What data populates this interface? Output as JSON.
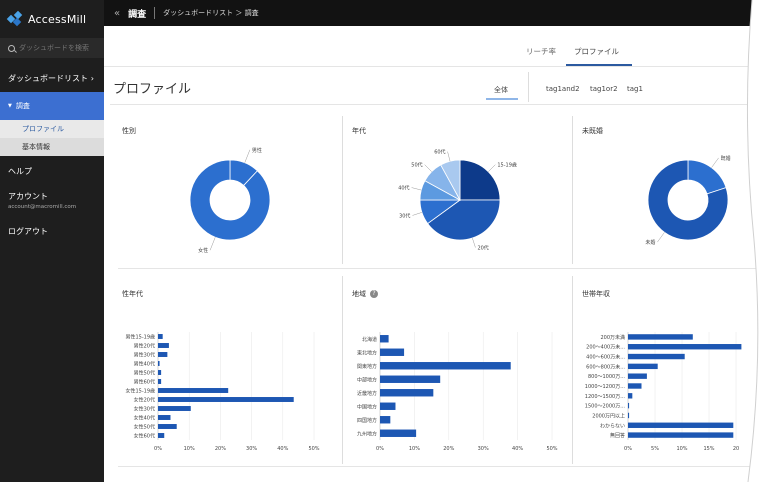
{
  "sidebar": {
    "logo": "AccessMill",
    "search_placeholder": "ダッシュボードを検索",
    "dashboard_list": "ダッシュボードリスト",
    "survey": "調査",
    "sub_items": [
      "プロファイル",
      "基本情報"
    ],
    "help": "ヘルプ",
    "account": "アカウント",
    "email": "account@macromill.com",
    "logout": "ログアウト"
  },
  "topbar": {
    "title": "調査",
    "breadcrumb": "ダッシュボードリスト ＞ 調査"
  },
  "tabs": [
    "リーチ率",
    "プロファイル"
  ],
  "page": {
    "title": "プロファイル"
  },
  "filters": [
    "全体",
    "tag1and2",
    "tag1or2",
    "tag1"
  ],
  "colors": {
    "dark": "#0d3a8a",
    "mid": "#1d57b3",
    "accent": "#2c6fcf",
    "light": "#5c9ae0",
    "pale": "#a9c9ef"
  },
  "chart_data": [
    {
      "type": "pie",
      "title": "性別",
      "donut": true,
      "labels": [
        "男性",
        "女性"
      ],
      "values": [
        12,
        88
      ]
    },
    {
      "type": "pie",
      "title": "年代",
      "labels": [
        "15-19歳",
        "20代",
        "30代",
        "40代",
        "50代",
        "60代"
      ],
      "values": [
        25,
        40,
        10,
        8,
        9,
        8
      ]
    },
    {
      "type": "pie",
      "title": "未既婚",
      "donut": true,
      "labels": [
        "既婚",
        "未婚"
      ],
      "values": [
        20,
        80
      ]
    },
    {
      "type": "bar",
      "title": "性年代",
      "orientation": "horizontal",
      "categories": [
        "男性15-19歳",
        "男性20代",
        "男性30代",
        "男性40代",
        "男性50代",
        "男性60代",
        "女性15-19歳",
        "女性20代",
        "女性30代",
        "女性40代",
        "女性50代",
        "女性60代"
      ],
      "values": [
        1.5,
        3.5,
        3,
        0.5,
        1,
        1,
        22.5,
        43.5,
        10.5,
        4,
        6,
        2
      ],
      "xlim": [
        0,
        50
      ],
      "xticks": [
        "0%",
        "10%",
        "20%",
        "30%",
        "40%",
        "50%"
      ]
    },
    {
      "type": "bar",
      "title": "地域",
      "orientation": "horizontal",
      "categories": [
        "北海道",
        "東北地方",
        "関東地方",
        "中部地方",
        "近畿地方",
        "中国地方",
        "四国地方",
        "九州地方"
      ],
      "values": [
        2.5,
        7,
        38,
        17.5,
        15.5,
        4.5,
        3,
        10.5
      ],
      "xlim": [
        0,
        50
      ],
      "xticks": [
        "0%",
        "10%",
        "20%",
        "30%",
        "40%",
        "50%"
      ]
    },
    {
      "type": "bar",
      "title": "世帯年収",
      "orientation": "horizontal",
      "categories": [
        "200万未満",
        "200〜400万未...",
        "400〜600万未...",
        "600〜800万未...",
        "800〜1000万...",
        "1000〜1200万...",
        "1200〜1500万...",
        "1500〜2000万...",
        "2000万円以上",
        "わからない",
        "無回答"
      ],
      "values": [
        12,
        21,
        10.5,
        5.5,
        3.5,
        2.5,
        0.8,
        0.2,
        0.2,
        19.5,
        19.5
      ],
      "xlim": [
        0,
        20
      ],
      "xticks": [
        "0%",
        "5%",
        "10%",
        "15%",
        "20"
      ]
    }
  ]
}
